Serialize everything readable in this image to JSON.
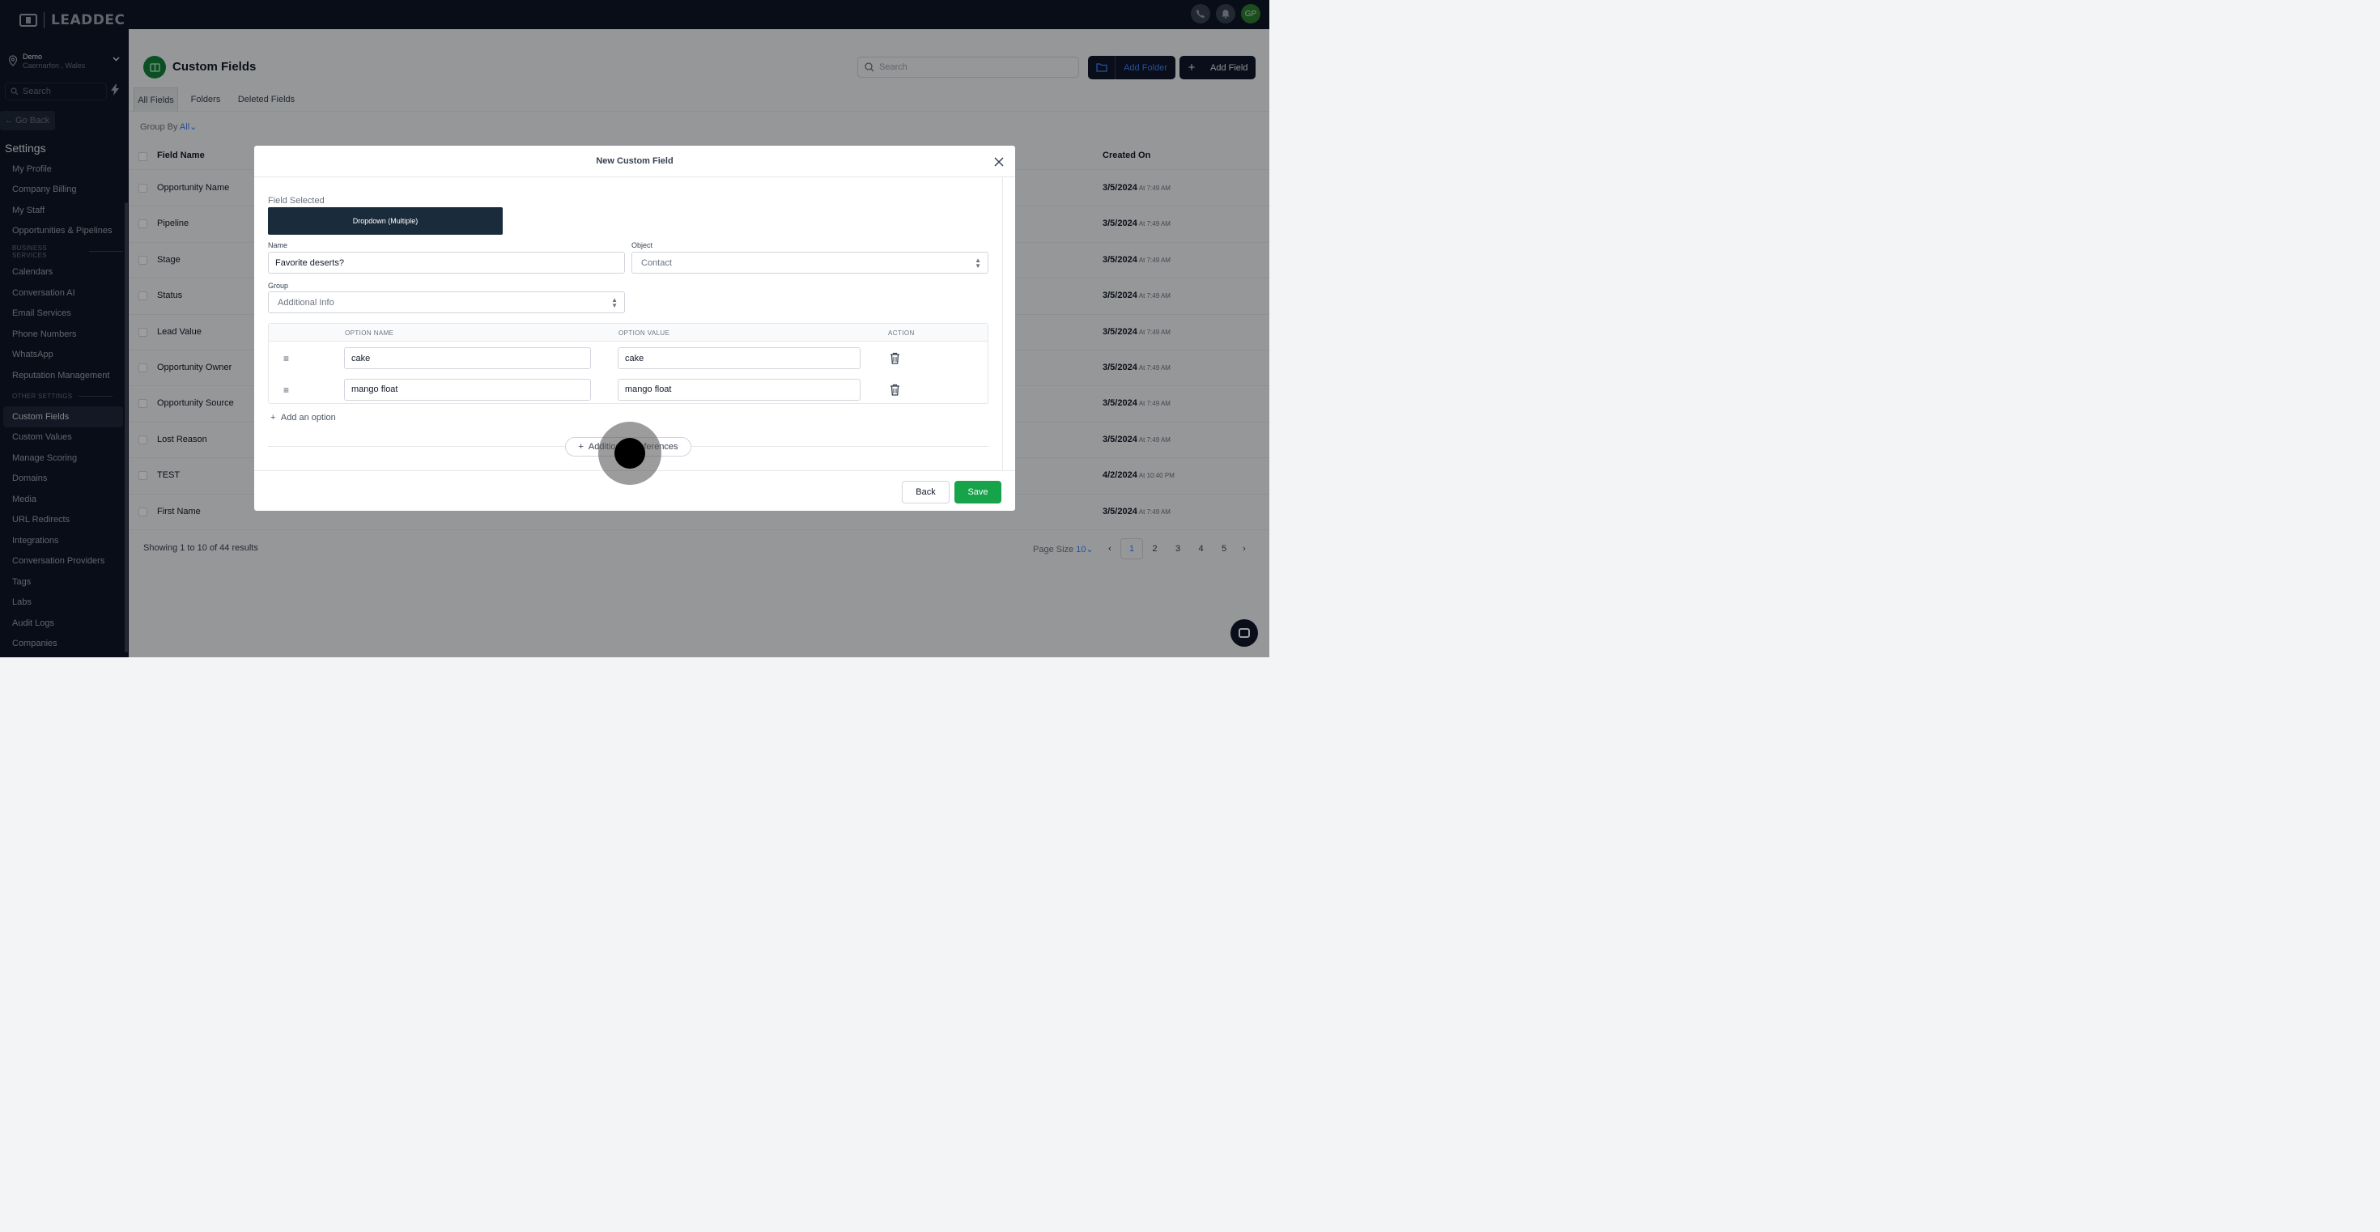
{
  "sidebar": {
    "logo": "LEADDEC",
    "location": {
      "name": "Demo",
      "subtitle": "Caernarfon , Wales"
    },
    "search_placeholder": "Search",
    "go_back": "Go Back",
    "title": "Settings",
    "items": [
      {
        "type": "item",
        "label": "My Profile"
      },
      {
        "type": "item",
        "label": "Company Billing"
      },
      {
        "type": "item",
        "label": "My Staff"
      },
      {
        "type": "item",
        "label": "Opportunities & Pipelines"
      },
      {
        "type": "section",
        "label": "BUSINESS SERVICES"
      },
      {
        "type": "item",
        "label": "Calendars"
      },
      {
        "type": "item",
        "label": "Conversation AI"
      },
      {
        "type": "item",
        "label": "Email Services"
      },
      {
        "type": "item",
        "label": "Phone Numbers"
      },
      {
        "type": "item",
        "label": "WhatsApp"
      },
      {
        "type": "item",
        "label": "Reputation Management"
      },
      {
        "type": "section",
        "label": "OTHER SETTINGS"
      },
      {
        "type": "item",
        "label": "Custom Fields",
        "active": true
      },
      {
        "type": "item",
        "label": "Custom Values"
      },
      {
        "type": "item",
        "label": "Manage Scoring"
      },
      {
        "type": "item",
        "label": "Domains"
      },
      {
        "type": "item",
        "label": "Media"
      },
      {
        "type": "item",
        "label": "URL Redirects"
      },
      {
        "type": "item",
        "label": "Integrations"
      },
      {
        "type": "item",
        "label": "Conversation Providers"
      },
      {
        "type": "item",
        "label": "Tags"
      },
      {
        "type": "item",
        "label": "Labs"
      },
      {
        "type": "item",
        "label": "Audit Logs"
      },
      {
        "type": "item",
        "label": "Companies"
      }
    ]
  },
  "topbar": {
    "avatar": "GP"
  },
  "page": {
    "title": "Custom Fields",
    "search_placeholder": "Search",
    "add_folder": "Add Folder",
    "add_field": "Add Field",
    "tabs": [
      "All Fields",
      "Folders",
      "Deleted Fields"
    ],
    "group_by_label": "Group By",
    "group_by_value": "All",
    "columns": {
      "name": "Field Name",
      "created": "Created On"
    },
    "rows": [
      {
        "name": "Opportunity Name",
        "date": "3/5/2024",
        "time": "At 7:49 AM"
      },
      {
        "name": "Pipeline",
        "date": "3/5/2024",
        "time": "At 7:49 AM"
      },
      {
        "name": "Stage",
        "date": "3/5/2024",
        "time": "At 7:49 AM"
      },
      {
        "name": "Status",
        "date": "3/5/2024",
        "time": "At 7:49 AM"
      },
      {
        "name": "Lead Value",
        "date": "3/5/2024",
        "time": "At 7:49 AM"
      },
      {
        "name": "Opportunity Owner",
        "date": "3/5/2024",
        "time": "At 7:49 AM"
      },
      {
        "name": "Opportunity Source",
        "date": "3/5/2024",
        "time": "At 7:49 AM"
      },
      {
        "name": "Lost Reason",
        "date": "3/5/2024",
        "time": "At 7:49 AM"
      },
      {
        "name": "TEST",
        "date": "4/2/2024",
        "time": "At 10:40 PM"
      },
      {
        "name": "First Name",
        "date": "3/5/2024",
        "time": "At 7:49 AM"
      }
    ],
    "showing": "Showing 1 to 10 of 44 results",
    "page_size_label": "Page Size",
    "page_size_value": "10",
    "pages": [
      "1",
      "2",
      "3",
      "4",
      "5"
    ],
    "current_page": "1"
  },
  "modal": {
    "title": "New Custom Field",
    "field_selected_label": "Field Selected",
    "field_type": "Dropdown (Multiple)",
    "name_label": "Name",
    "name_value": "Favorite deserts?",
    "object_label": "Object",
    "object_value": "Contact",
    "group_label": "Group",
    "group_value": "Additional Info",
    "options_headers": {
      "name": "OPTION NAME",
      "value": "OPTION VALUE",
      "action": "ACTION"
    },
    "options": [
      {
        "name": "cake",
        "value": "cake"
      },
      {
        "name": "mango float",
        "value": "mango float"
      }
    ],
    "add_option": "Add an option",
    "additional_preferences": "Additional Preferences",
    "back": "Back",
    "save": "Save"
  }
}
